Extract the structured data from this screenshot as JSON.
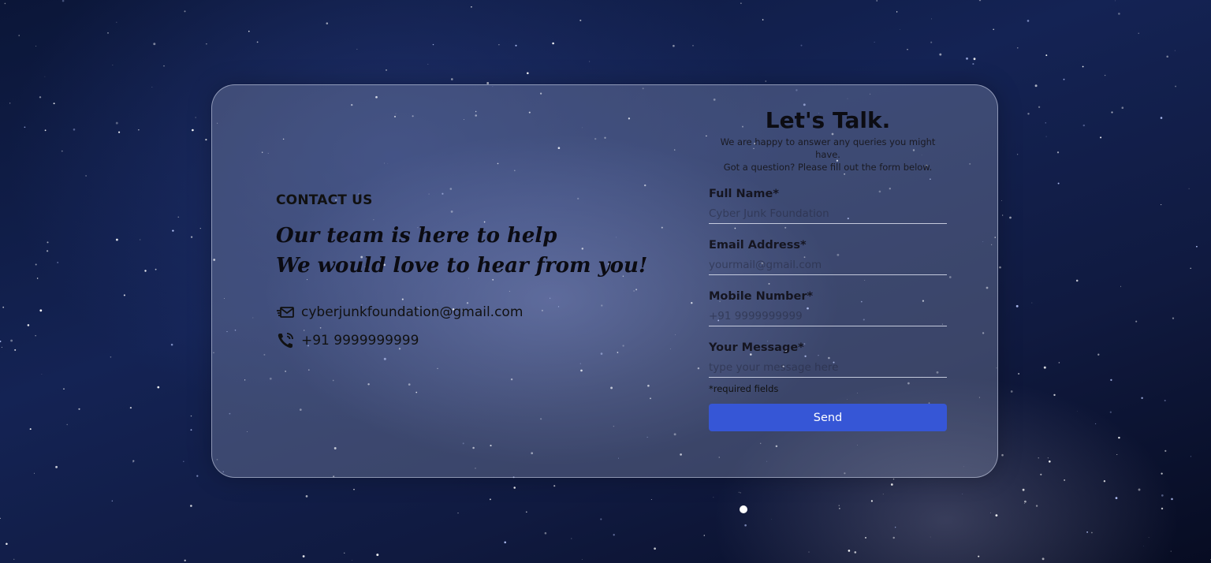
{
  "contact": {
    "heading": "CONTACT US",
    "tagline_line1": "Our team is here to help",
    "tagline_line2": "We would love to hear from you!",
    "email": "cyberjunkfoundation@gmail.com",
    "phone": "+91 9999999999",
    "email_icon": "mail-send-icon",
    "phone_icon": "phone-call-icon"
  },
  "form": {
    "title": "Let's Talk.",
    "subtitle_line1": "We are happy to answer any queries you might have.",
    "subtitle_line2": "Got a question? Please fill out the form below.",
    "fields": [
      {
        "label": "Full Name*",
        "placeholder": "Cyber Junk Foundation",
        "value": ""
      },
      {
        "label": "Email Address*",
        "placeholder": "yourmail@gmail.com",
        "value": ""
      },
      {
        "label": "Mobile Number*",
        "placeholder": "+91 9999999999",
        "value": ""
      },
      {
        "label": "Your Message*",
        "placeholder": "type your message here",
        "value": ""
      }
    ],
    "required_note": "*required fields",
    "send_label": "Send"
  },
  "colors": {
    "button": "#3656d6",
    "background": "#0f1c46"
  }
}
